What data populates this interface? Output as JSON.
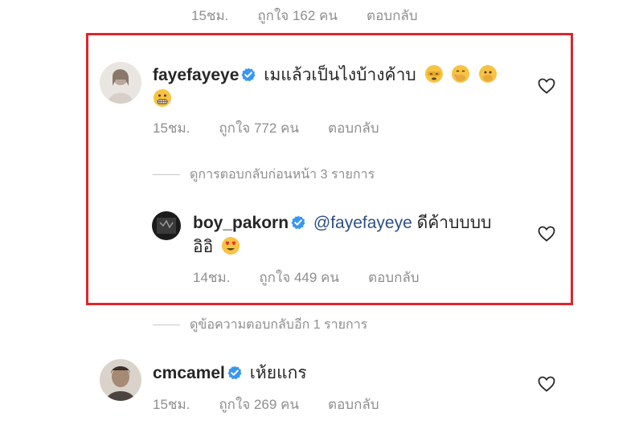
{
  "top_comment": {
    "time": "15ชม.",
    "likes": "ถูกใจ 162 คน",
    "reply": "ตอบกลับ"
  },
  "comment_faye": {
    "username": "fayefayeye",
    "text": "เมแล้วเป็นไงบ้างค้าบ",
    "emojis": [
      "eyes-closed-peek-emoji",
      "hand-over-mouth-emoji",
      "hand-over-mouth-emoji",
      "grimacing-emoji"
    ],
    "time": "15ชม.",
    "likes": "ถูกใจ 772 คน",
    "reply": "ตอบกลับ",
    "view_previous": "ดูการตอบกลับก่อนหน้า 3 รายการ"
  },
  "reply_boy": {
    "username": "boy_pakorn",
    "mention": "@fayefayeye",
    "text_line1": "ดีค้าบบบบ",
    "text_line2": "อิอิ",
    "emoji": "heart-eyes-emoji",
    "time": "14ชม.",
    "likes": "ถูกใจ 449 คน",
    "reply": "ตอบกลับ"
  },
  "more_replies": "ดูข้อความตอบกลับอีก 1 รายการ",
  "comment_cm": {
    "username": "cmcamel",
    "text": "เห้ยแกร",
    "time": "15ชม.",
    "likes": "ถูกใจ 269 คน",
    "reply": "ตอบกลับ"
  },
  "colors": {
    "highlight": "#e0242b",
    "verified": "#3897f0",
    "mention": "#2f4f87",
    "meta": "#8e8e8e"
  }
}
